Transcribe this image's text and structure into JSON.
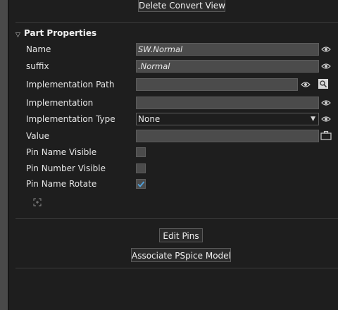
{
  "top": {
    "delete_convert_view": "Delete Convert View"
  },
  "section": {
    "title": "Part Properties"
  },
  "fields": {
    "name": {
      "label": "Name",
      "value": "SW.Normal"
    },
    "suffix": {
      "label": "suffix",
      "value": ".Normal"
    },
    "implementation_path": {
      "label": "Implementation Path",
      "value": ""
    },
    "implementation": {
      "label": "Implementation",
      "value": ""
    },
    "implementation_type": {
      "label": "Implementation Type",
      "value": "None"
    },
    "value": {
      "label": "Value",
      "value": ""
    },
    "pin_name_visible": {
      "label": "Pin Name Visible",
      "checked": false
    },
    "pin_number_visible": {
      "label": "Pin Number Visible",
      "checked": false
    },
    "pin_name_rotate": {
      "label": "Pin Name Rotate",
      "checked": true
    }
  },
  "actions": {
    "edit_pins": "Edit Pins",
    "associate_pspice": "Associate PSpice Model"
  },
  "colors": {
    "accent_check": "#4fa3e0",
    "background": "#1e1e1e",
    "field": "#4b4b4b"
  },
  "icons": [
    "eye-icon",
    "search-icon",
    "briefcase-icon",
    "expand-icon",
    "chevron-down-icon",
    "checkmark-icon"
  ]
}
